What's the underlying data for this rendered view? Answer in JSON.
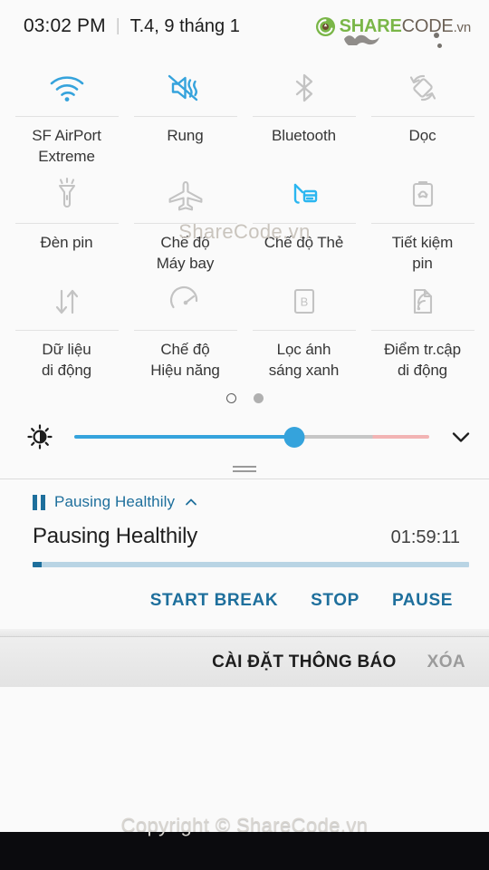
{
  "statusbar": {
    "time": "03:02 PM",
    "separator": "|",
    "date": "T.4, 9 tháng 1",
    "logo": {
      "share": "SHARE",
      "code": "CODE",
      "vn": ".vn"
    }
  },
  "quick_settings": {
    "rows": [
      [
        {
          "icon": "wifi-icon",
          "label": "SF AirPort\nExtreme",
          "active": true
        },
        {
          "icon": "vibrate-icon",
          "label": "Rung",
          "active": true
        },
        {
          "icon": "bluetooth-icon",
          "label": "Bluetooth",
          "active": false
        },
        {
          "icon": "auto-rotate-icon",
          "label": "Dọc",
          "active": false
        }
      ],
      [
        {
          "icon": "flashlight-icon",
          "label": "Đèn pin",
          "active": false
        },
        {
          "icon": "airplane-icon",
          "label": "Chế độ\nMáy bay",
          "active": false
        },
        {
          "icon": "card-mode-icon",
          "label": "Chế độ Thẻ",
          "active": true
        },
        {
          "icon": "power-saving-icon",
          "label": "Tiết kiệm\npin",
          "active": false
        }
      ],
      [
        {
          "icon": "mobile-data-icon",
          "label": "Dữ liệu\ndi động",
          "active": false
        },
        {
          "icon": "performance-icon",
          "label": "Chế độ\nHiệu năng",
          "active": false
        },
        {
          "icon": "blue-light-icon",
          "label": "Lọc ánh\nsáng xanh",
          "active": false
        },
        {
          "icon": "mobile-hotspot-icon",
          "label": "Điểm tr.cập\ndi động",
          "active": false
        }
      ]
    ],
    "page_indicator": {
      "current": 1,
      "total": 2
    }
  },
  "brightness": {
    "icon": "brightness-icon",
    "value_percent": 62,
    "expand_icon": "chevron-down-icon"
  },
  "notification": {
    "app_icon": "pause-icon",
    "app_name": "Pausing Healthily",
    "collapse_icon": "chevron-up-icon",
    "title": "Pausing Healthily",
    "timer": "01:59:11",
    "progress_percent": 2,
    "actions": [
      "START BREAK",
      "STOP",
      "PAUSE"
    ]
  },
  "footer": {
    "settings_label": "CÀI ĐẶT THÔNG BÁO",
    "clear_label": "XÓA"
  },
  "watermarks": {
    "center": "ShareCode.vn",
    "bottom": "Copyright © ShareCode.vn"
  },
  "colors": {
    "accent_blue": "#35a3dc",
    "notification_blue": "#1e6f9c",
    "inactive_gray": "#bdbdbd",
    "logo_green": "#7ab648",
    "background": "#fafafa"
  }
}
